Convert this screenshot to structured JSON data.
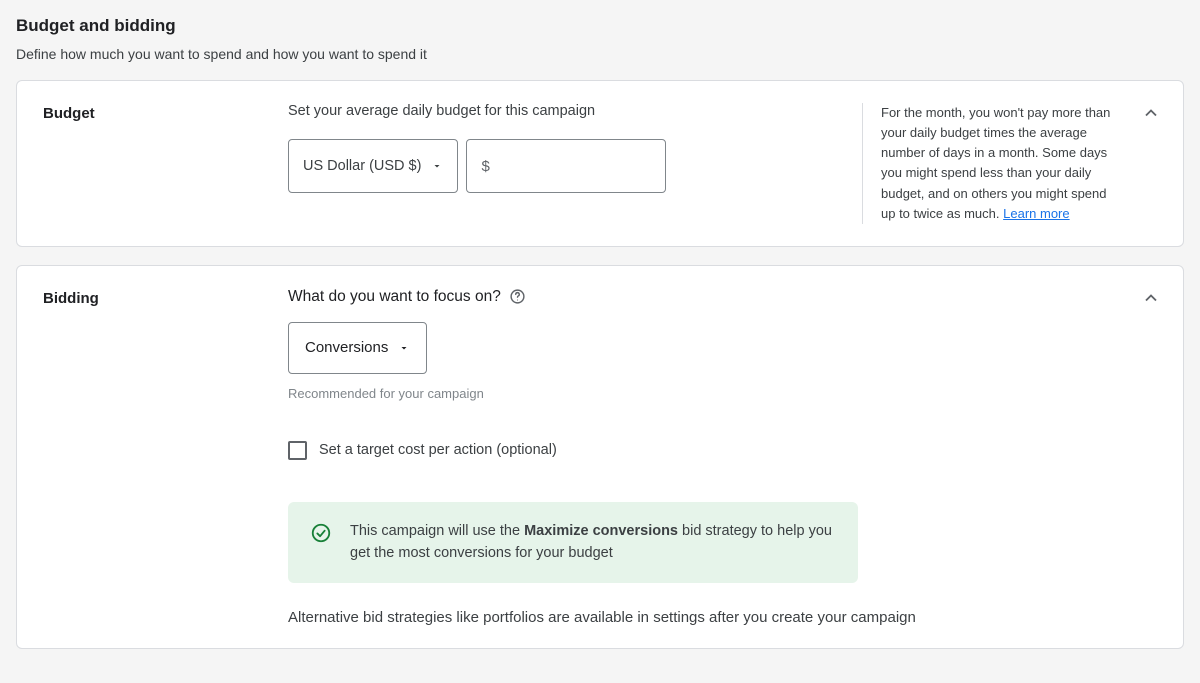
{
  "header": {
    "title": "Budget and bidding",
    "subtitle": "Define how much you want to spend and how you want to spend it"
  },
  "budget": {
    "section_label": "Budget",
    "instruction": "Set your average daily budget for this campaign",
    "currency_label": "US Dollar (USD $)",
    "amount_prefix": "$",
    "amount_value": "",
    "aside_text": "For the month, you won't pay more than your daily budget times the average number of days in a month. Some days you might spend less than your daily budget, and on others you might spend up to twice as much. ",
    "learn_more": "Learn more"
  },
  "bidding": {
    "section_label": "Bidding",
    "focus_question": "What do you want to focus on?",
    "focus_value": "Conversions",
    "recommended_text": "Recommended for your campaign",
    "target_cpa_checkbox_label": "Set a target cost per action (optional)",
    "callout_prefix": "This campaign will use the ",
    "callout_bold": "Maximize conversions",
    "callout_suffix": " bid strategy to help you get the most conversions for your budget",
    "alt_note": "Alternative bid strategies like portfolios are available in settings after you create your campaign"
  }
}
